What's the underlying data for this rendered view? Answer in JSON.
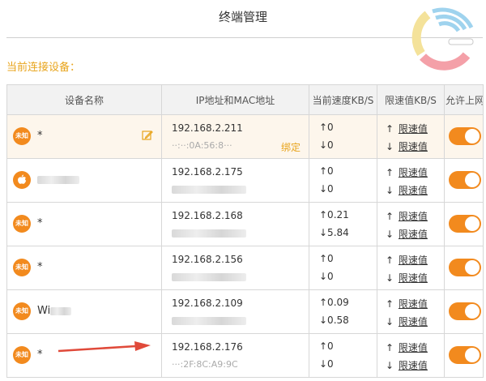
{
  "page": {
    "title": "终端管理",
    "section_label": "当前连接设备："
  },
  "table": {
    "headers": [
      "设备名称",
      "IP地址和MAC地址",
      "当前速度KB/S",
      "限速值KB/S",
      "允许上网"
    ],
    "unknown_badge": "未知",
    "bind_label": "绑定",
    "limit_label": "限速值",
    "rows": [
      {
        "icon": "unknown",
        "name": "*",
        "ip": "192.168.2.211",
        "mac": "··:··:0A:56:8···",
        "up": "↑0",
        "down": "↓0",
        "limit_up": "↑",
        "limit_down": "↓",
        "highlight": true
      },
      {
        "icon": "apple",
        "name": "",
        "ip": "192.168.2.175",
        "mac": "",
        "up": "↑0",
        "down": "↓0",
        "limit_up": "↑",
        "limit_down": "↓"
      },
      {
        "icon": "unknown",
        "name": "*",
        "ip": "192.168.2.168",
        "mac": "",
        "up": "↑0.21",
        "down": "↓5.84",
        "limit_up": "↑",
        "limit_down": "↓"
      },
      {
        "icon": "unknown",
        "name": "*",
        "ip": "192.168.2.156",
        "mac": "",
        "up": "↑0",
        "down": "↓0",
        "limit_up": "↑",
        "limit_down": "↓"
      },
      {
        "icon": "unknown",
        "name": "Wi",
        "ip": "192.168.2.109",
        "mac": "",
        "up": "↑0.09",
        "down": "↓0.58",
        "limit_up": "↑",
        "limit_down": "↓"
      },
      {
        "icon": "unknown",
        "name": "*",
        "ip": "192.168.2.176",
        "mac": "···:2F:8C:A9:9C",
        "up": "↑0",
        "down": "↓0",
        "limit_up": "↑",
        "limit_down": "↓"
      }
    ]
  },
  "colors": {
    "accent": "#f28a1e",
    "label": "#e8a41c",
    "arrow": "#e04a3a"
  }
}
